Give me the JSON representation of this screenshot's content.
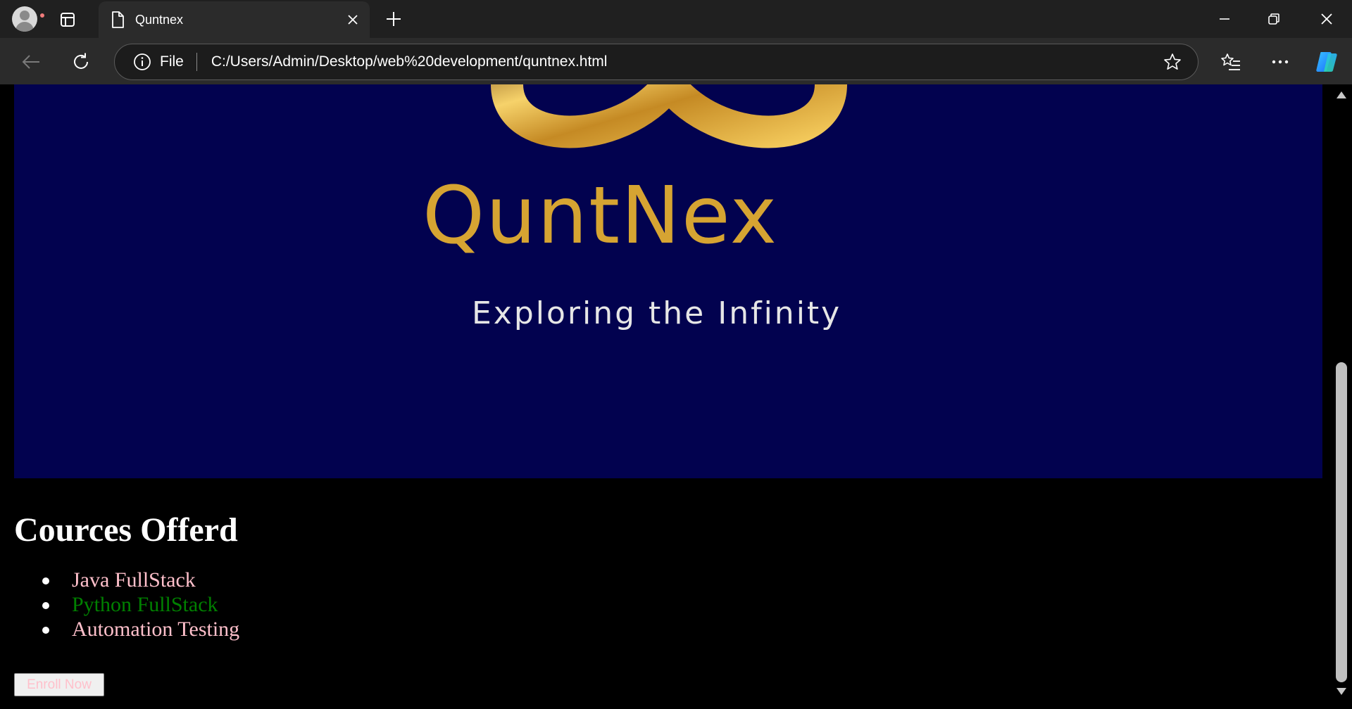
{
  "browser": {
    "tab": {
      "title": "Quntnex",
      "icon": "page-icon"
    },
    "address": {
      "scheme": "File",
      "url": "C:/Users/Admin/Desktop/web%20development/quntnex.html"
    }
  },
  "page": {
    "banner": {
      "logo_text": "QuntNex",
      "tagline": "Exploring the Infinity",
      "background": "#02024f",
      "logo_color": "#d6a432"
    },
    "heading": "Cources Offerd",
    "courses": [
      {
        "label": "Java FullStack",
        "color": "#ffc0cb"
      },
      {
        "label": "Python FullStack",
        "color": "#008000"
      },
      {
        "label": "Automation Testing",
        "color": "#ffc0cb"
      }
    ],
    "button": {
      "label": "Enroll Now",
      "color": "#ffc0cb"
    }
  }
}
